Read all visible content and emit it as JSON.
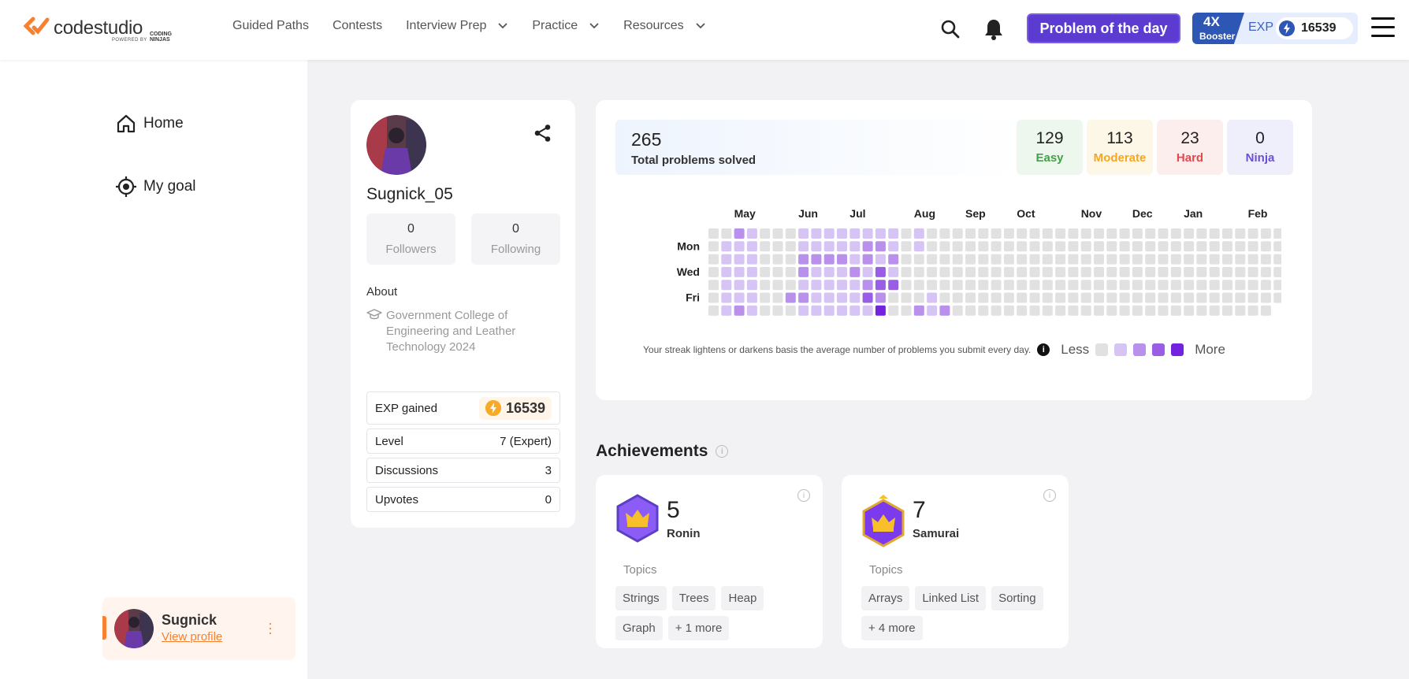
{
  "header": {
    "brand": "codestudio",
    "powered_by": "POWERED BY",
    "coding_ninjas": "CODING NINJAS",
    "nav": [
      {
        "label": "Guided Paths",
        "dropdown": false
      },
      {
        "label": "Contests",
        "dropdown": false
      },
      {
        "label": "Interview Prep",
        "dropdown": true
      },
      {
        "label": "Practice",
        "dropdown": true
      },
      {
        "label": "Resources",
        "dropdown": true
      }
    ],
    "potd_label": "Problem of the day",
    "booster": {
      "multiplier": "4X",
      "label": "Booster",
      "exp_label": "EXP",
      "exp_value": "16539"
    }
  },
  "sidebar": {
    "home": "Home",
    "goal": "My goal",
    "user": {
      "name": "Sugnick",
      "link": "View profile"
    }
  },
  "profile": {
    "username": "Sugnick_05",
    "followers": {
      "count": "0",
      "label": "Followers"
    },
    "following": {
      "count": "0",
      "label": "Following"
    },
    "about_heading": "About",
    "about_text": "Government College of Engineering and Leather Technology 2024",
    "exp_label": "EXP gained",
    "exp_value": "16539",
    "rows": [
      {
        "label": "Level",
        "value": "7 (Expert)"
      },
      {
        "label": "Discussions",
        "value": "3"
      },
      {
        "label": "Upvotes",
        "value": "0"
      }
    ]
  },
  "stats": {
    "total": "265",
    "total_label": "Total problems solved",
    "difficulty": [
      {
        "count": "129",
        "label": "Easy",
        "color": "#43a047",
        "bg": "#eef7ee"
      },
      {
        "count": "113",
        "label": "Moderate",
        "color": "#f5a623",
        "bg": "#fdf7e8"
      },
      {
        "count": "23",
        "label": "Hard",
        "color": "#e5484d",
        "bg": "#fdeeee"
      },
      {
        "count": "0",
        "label": "Ninja",
        "color": "#6b4fd3",
        "bg": "#efeefb"
      }
    ]
  },
  "heatmap": {
    "months": [
      {
        "label": "May",
        "week": 2
      },
      {
        "label": "Jun",
        "week": 7
      },
      {
        "label": "Jul",
        "week": 11
      },
      {
        "label": "Aug",
        "week": 16
      },
      {
        "label": "Sep",
        "week": 20
      },
      {
        "label": "Oct",
        "week": 24
      },
      {
        "label": "Nov",
        "week": 29
      },
      {
        "label": "Dec",
        "week": 33
      },
      {
        "label": "Jan",
        "week": 37
      },
      {
        "label": "Feb",
        "week": 42
      }
    ],
    "day_labels": [
      {
        "label": "Mon",
        "row": 1
      },
      {
        "label": "Wed",
        "row": 3
      },
      {
        "label": "Fri",
        "row": 5
      }
    ],
    "colors": [
      "#e1e1e1",
      "#d6c4f4",
      "#b990ec",
      "#9a5ee6",
      "#7323e0"
    ],
    "grid": [
      [
        0,
        0,
        2,
        1,
        0,
        0,
        0,
        1,
        1,
        1,
        1,
        1,
        1,
        1,
        1,
        0,
        1,
        0,
        0,
        0,
        0,
        0,
        0,
        0,
        0,
        0,
        0,
        0,
        0,
        0,
        0,
        0,
        0,
        0,
        0,
        0,
        0,
        0,
        0,
        0,
        0,
        0,
        0,
        0,
        0
      ],
      [
        0,
        1,
        1,
        1,
        0,
        0,
        0,
        1,
        1,
        1,
        1,
        1,
        2,
        2,
        1,
        0,
        1,
        0,
        0,
        0,
        0,
        0,
        0,
        0,
        0,
        0,
        0,
        0,
        0,
        0,
        0,
        0,
        0,
        0,
        0,
        0,
        0,
        0,
        0,
        0,
        0,
        0,
        0,
        0,
        0
      ],
      [
        0,
        1,
        1,
        1,
        0,
        0,
        0,
        2,
        2,
        2,
        2,
        1,
        2,
        1,
        2,
        0,
        0,
        0,
        0,
        0,
        0,
        0,
        0,
        0,
        0,
        0,
        0,
        0,
        0,
        0,
        0,
        0,
        0,
        0,
        0,
        0,
        0,
        0,
        0,
        0,
        0,
        0,
        0,
        0,
        0
      ],
      [
        0,
        1,
        1,
        1,
        0,
        0,
        0,
        2,
        1,
        1,
        1,
        2,
        1,
        3,
        1,
        0,
        0,
        0,
        0,
        0,
        0,
        0,
        0,
        0,
        0,
        0,
        0,
        0,
        0,
        0,
        0,
        0,
        0,
        0,
        0,
        0,
        0,
        0,
        0,
        0,
        0,
        0,
        0,
        0,
        0
      ],
      [
        0,
        1,
        1,
        1,
        0,
        0,
        0,
        1,
        1,
        1,
        1,
        1,
        2,
        3,
        3,
        0,
        0,
        0,
        0,
        0,
        0,
        0,
        0,
        0,
        0,
        0,
        0,
        0,
        0,
        0,
        0,
        0,
        0,
        0,
        0,
        0,
        0,
        0,
        0,
        0,
        0,
        0,
        0,
        0,
        0
      ],
      [
        0,
        1,
        1,
        1,
        0,
        0,
        2,
        2,
        1,
        1,
        1,
        1,
        3,
        2,
        0,
        0,
        0,
        1,
        0,
        0,
        0,
        0,
        0,
        0,
        0,
        0,
        0,
        0,
        0,
        0,
        0,
        0,
        0,
        0,
        0,
        0,
        0,
        0,
        0,
        0,
        0,
        0,
        0,
        0,
        0
      ],
      [
        0,
        1,
        2,
        1,
        0,
        0,
        0,
        1,
        1,
        1,
        1,
        1,
        1,
        4,
        0,
        0,
        2,
        1,
        2,
        0,
        0,
        0,
        0,
        0,
        0,
        0,
        0,
        0,
        0,
        0,
        0,
        0,
        0,
        0,
        0,
        0,
        0,
        0,
        0,
        0,
        0,
        0,
        0,
        0,
        -1
      ]
    ],
    "note": "Your streak lightens or darkens basis the average number of problems you submit every day.",
    "less": "Less",
    "more": "More"
  },
  "achievements": {
    "title": "Achievements",
    "cards": [
      {
        "count": "5",
        "rank": "Ronin",
        "topics_label": "Topics",
        "tags": [
          "Strings",
          "Trees",
          "Heap",
          "Graph",
          "+ 1 more"
        ]
      },
      {
        "count": "7",
        "rank": "Samurai",
        "topics_label": "Topics",
        "tags": [
          "Arrays",
          "Linked List",
          "Sorting",
          "+ 4 more"
        ]
      }
    ]
  }
}
